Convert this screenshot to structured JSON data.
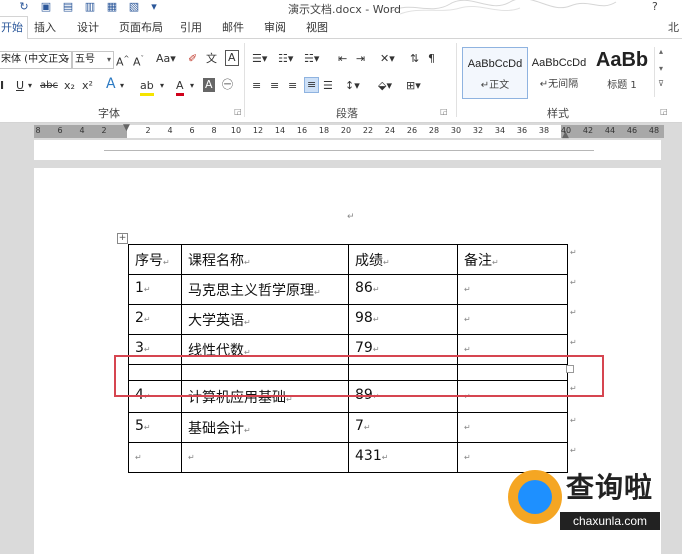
{
  "window": {
    "title": "演示文档.docx - Word",
    "help_symbol": "?"
  },
  "tabs": [
    "开始",
    "插入",
    "设计",
    "页面布局",
    "引用",
    "邮件",
    "审阅",
    "视图"
  ],
  "user_label": "北",
  "ribbon": {
    "font_name": "宋体 (中文正文",
    "font_size": "五号",
    "groups": {
      "font": "字体",
      "paragraph": "段落",
      "styles": "样式"
    },
    "styles": [
      {
        "sample": "AaBbCcDd",
        "name": "↵正文"
      },
      {
        "sample": "AaBbCcDd",
        "name": "↵无间隔"
      },
      {
        "sample": "AaBb",
        "name": "标题 1"
      }
    ]
  },
  "ruler": {
    "numbers": [
      "8",
      "6",
      "4",
      "2",
      "2",
      "4",
      "6",
      "8",
      "10",
      "12",
      "14",
      "16",
      "18",
      "20",
      "22",
      "24",
      "26",
      "28",
      "30",
      "32",
      "34",
      "36",
      "38",
      "40",
      "42",
      "44",
      "46",
      "48"
    ]
  },
  "table": {
    "header": [
      "序号",
      "课程名称",
      "成绩",
      "备注"
    ],
    "rows": [
      [
        "1",
        "马克思主义哲学原理",
        "86",
        ""
      ],
      [
        "2",
        "大学英语",
        "98",
        ""
      ],
      [
        "3",
        "线性代数",
        "79",
        ""
      ],
      [
        "",
        "",
        "",
        ""
      ],
      [
        "4",
        "计算机应用基础",
        "89",
        ""
      ],
      [
        "5",
        "基础会计",
        "7",
        ""
      ],
      [
        "",
        "",
        "431",
        ""
      ]
    ],
    "paragraph_mark": "↵"
  },
  "watermark": {
    "text": "查询啦",
    "url_text": "chaxunla.com"
  },
  "colors": {
    "accent": "#2b579a",
    "highlight_border": "#d64550"
  }
}
